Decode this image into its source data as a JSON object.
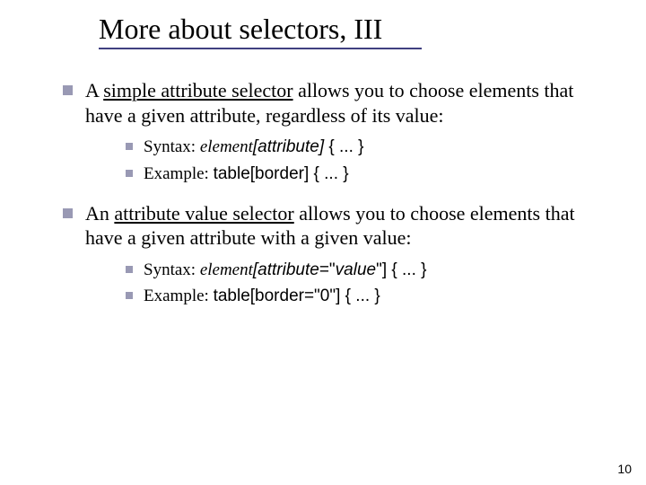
{
  "title": "More about selectors, III",
  "b1": {
    "pre": "A ",
    "term": "simple attribute selector",
    "post": " allows you to choose elements that have a given attribute, regardless of its value:",
    "syntax": {
      "label": "Syntax:  ",
      "el": "element",
      "attr": "[attribute]",
      "rest": " { ... }"
    },
    "example": {
      "label": "Example:  ",
      "code": "table[border] { ... }"
    }
  },
  "b2": {
    "pre": "An ",
    "term": "attribute value selector",
    "post": " allows you to choose elements that have a given attribute with a given value:",
    "syntax": {
      "label": "Syntax:  ",
      "el": "element",
      "attr": "[attribute",
      "eq": "=\"",
      "val": "value",
      "close": "\"]",
      "rest": " { ... }"
    },
    "example": {
      "label": "Example:  ",
      "code": "table[border=\"0\"] { ... }"
    }
  },
  "pagenum": "10"
}
